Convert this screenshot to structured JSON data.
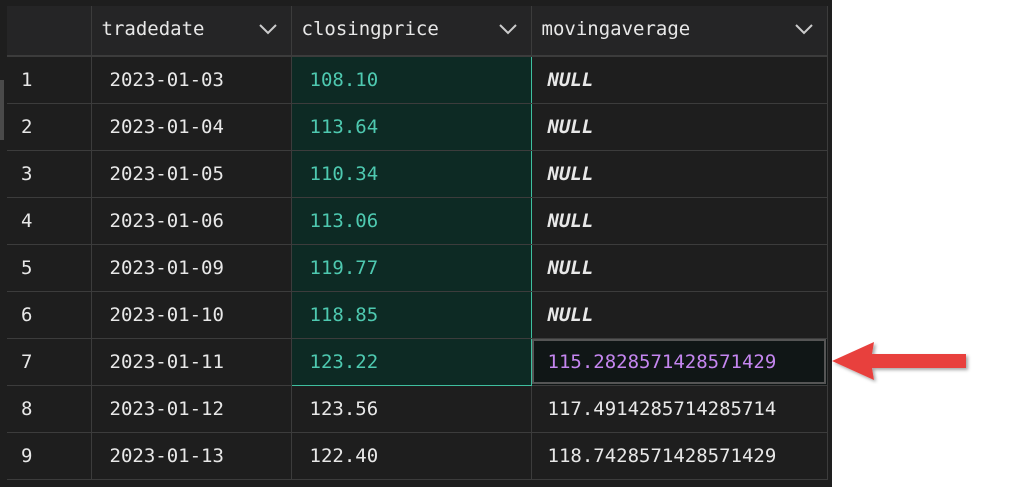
{
  "grid": {
    "columns": [
      {
        "label": ""
      },
      {
        "label": "tradedate"
      },
      {
        "label": "closingprice"
      },
      {
        "label": "movingaverage"
      }
    ],
    "rows": [
      {
        "idx": "1",
        "tradedate": "2023-01-03",
        "closingprice": "108.10",
        "movingaverage": "NULL"
      },
      {
        "idx": "2",
        "tradedate": "2023-01-04",
        "closingprice": "113.64",
        "movingaverage": "NULL"
      },
      {
        "idx": "3",
        "tradedate": "2023-01-05",
        "closingprice": "110.34",
        "movingaverage": "NULL"
      },
      {
        "idx": "4",
        "tradedate": "2023-01-06",
        "closingprice": "113.06",
        "movingaverage": "NULL"
      },
      {
        "idx": "5",
        "tradedate": "2023-01-09",
        "closingprice": "119.77",
        "movingaverage": "NULL"
      },
      {
        "idx": "6",
        "tradedate": "2023-01-10",
        "closingprice": "118.85",
        "movingaverage": "NULL"
      },
      {
        "idx": "7",
        "tradedate": "2023-01-11",
        "closingprice": "123.22",
        "movingaverage": "115.2828571428571429"
      },
      {
        "idx": "8",
        "tradedate": "2023-01-12",
        "closingprice": "123.56",
        "movingaverage": "117.4914285714285714"
      },
      {
        "idx": "9",
        "tradedate": "2023-01-13",
        "closingprice": "122.40",
        "movingaverage": "118.7428571428571429"
      }
    ],
    "selected_rows_closingprice": [
      1,
      2,
      3,
      4,
      5,
      6,
      7
    ],
    "highlighted_row_movingaverage": 7
  },
  "colors": {
    "grid_background": "#1e1e1e",
    "selection_text": "#4ec9b0",
    "selection_border": "#3fbf9f",
    "highlight_text": "#c586f0",
    "arrow": "#e8413e"
  },
  "icons": {
    "column_menu": "chevron-down-icon",
    "annotation": "red-arrow-icon"
  }
}
